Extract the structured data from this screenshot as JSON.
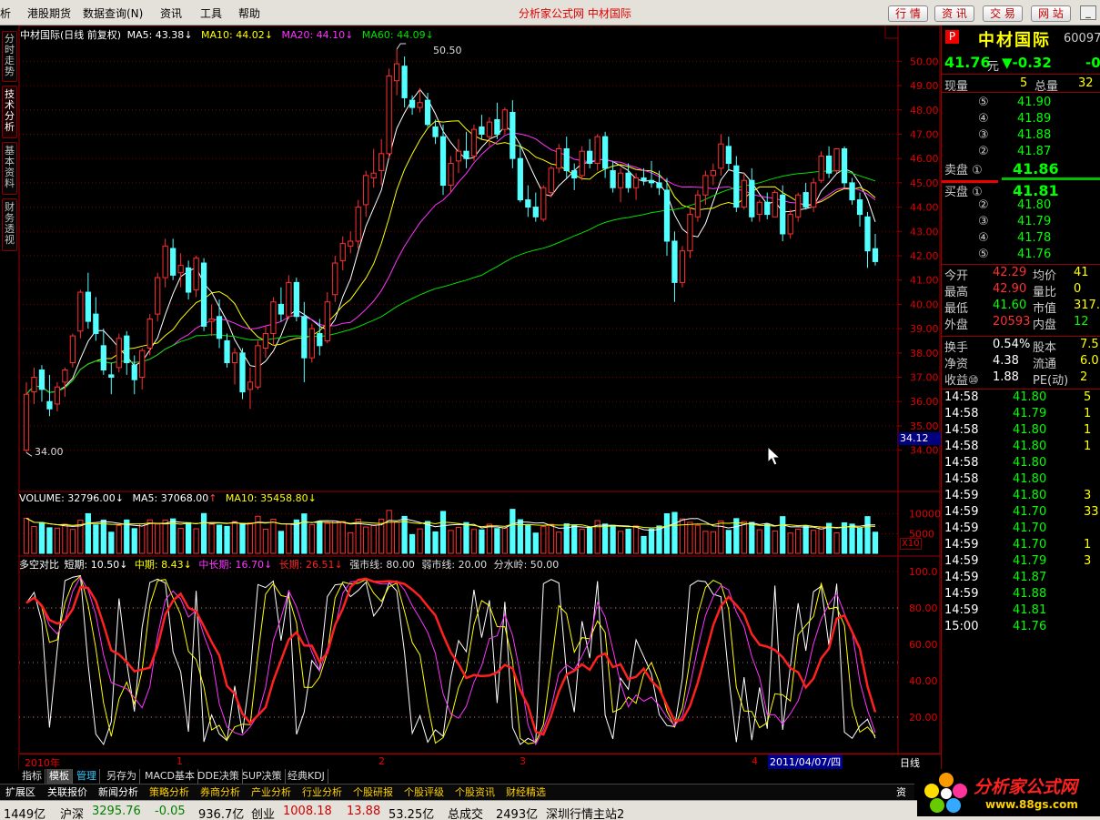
{
  "menubar": {
    "items": [
      "析",
      "港股期货",
      "数据查询(N)",
      "资讯",
      "工具",
      "帮助"
    ],
    "title": "分析家公式网 中材国际",
    "buttons": [
      "行 情",
      "资 讯",
      "交 易",
      "网 站"
    ],
    "win": [
      "_",
      "□",
      "×"
    ]
  },
  "lefttabs": [
    "分时走势",
    "技术分析",
    "基本资料",
    "财务透视"
  ],
  "main": {
    "stock_name": "中材国际(日线 前复权)",
    "ma": [
      {
        "label": "MA5: 43.38",
        "color": "#ffffff",
        "arrow": "↓"
      },
      {
        "label": "MA10: 44.02",
        "color": "#ffff00",
        "arrow": "↓"
      },
      {
        "label": "MA20: 44.10",
        "color": "#ff33ff",
        "arrow": "↓"
      },
      {
        "label": "MA60: 44.09",
        "color": "#00e000",
        "arrow": "↓"
      }
    ],
    "high_marker": "50.50",
    "low_marker": "34.00",
    "price_axis": [
      "50.00",
      "49.00",
      "48.00",
      "47.00",
      "46.00",
      "45.00",
      "44.00",
      "43.00",
      "42.00",
      "41.00",
      "40.00",
      "39.00",
      "38.00",
      "37.00",
      "36.00",
      "35.00",
      "34.00"
    ],
    "cursor_price": "34.12"
  },
  "volume": {
    "vol_label": "VOLUME: 32796.00",
    "vol_arrow": "↓",
    "ma5_label": "MA5: 37068.00",
    "ma5_arrow": "↑",
    "ma10_label": "MA10: 35458.80",
    "ma10_arrow": "↓",
    "axis": [
      "10000",
      "5000"
    ],
    "unit": "X10"
  },
  "indicator": {
    "name": "多空对比",
    "short": "短期: 10.50",
    "mid": "中期: 8.43",
    "midlong": "中长期: 16.70",
    "long": "长期: 26.51",
    "strong": "强市线: 80.00",
    "weak": "弱市线: 20.00",
    "water": "分水岭: 50.00",
    "axis": [
      "100.0",
      "80.00",
      "60.00",
      "40.00",
      "20.00"
    ]
  },
  "datebar": {
    "year": "2010年",
    "months": [
      "1",
      "2",
      "3",
      "4"
    ],
    "cursor_date": "2011/04/07/四",
    "period": "日线"
  },
  "quote": {
    "code": "P",
    "name": "中材国际",
    "code_num": "60097",
    "price": "41.76",
    "price_unit": "元",
    "change": "▼-0.32",
    "change2": "-0",
    "now_vol_label": "现量",
    "now_vol": "5",
    "total_label": "总量",
    "total": "32",
    "sells": [
      {
        "idx": "⑤",
        "price": "41.90"
      },
      {
        "idx": "④",
        "price": "41.89"
      },
      {
        "idx": "③",
        "price": "41.88"
      },
      {
        "idx": "②",
        "price": "41.87"
      },
      {
        "idx": "卖盘 ①",
        "price": "41.86"
      }
    ],
    "buys": [
      {
        "idx": "买盘 ①",
        "price": "41.81"
      },
      {
        "idx": "②",
        "price": "41.80"
      },
      {
        "idx": "③",
        "price": "41.79"
      },
      {
        "idx": "④",
        "price": "41.78"
      },
      {
        "idx": "⑤",
        "price": "41.76"
      }
    ],
    "stats": [
      {
        "l1": "今开",
        "v1": "42.29",
        "l2": "均价",
        "v2": "41"
      },
      {
        "l1": "最高",
        "v1": "42.90",
        "l2": "量比",
        "v2": "0"
      },
      {
        "l1": "最低",
        "v1": "41.60",
        "l2": "市值",
        "v2": "317."
      },
      {
        "l1": "外盘",
        "v1": "20593",
        "l2": "内盘",
        "v2": "12"
      }
    ],
    "fund": [
      {
        "l1": "换手",
        "v1": "0.54%",
        "l2": "股本",
        "v2": "7.5"
      },
      {
        "l1": "净资",
        "v1": "4.38",
        "l2": "流通",
        "v2": "6.0"
      },
      {
        "l1": "收益⑩",
        "v1": "1.88",
        "l2": "PE(动)",
        "v2": "2"
      }
    ],
    "ticks": [
      {
        "t": "14:58",
        "p": "41.80",
        "v": "5"
      },
      {
        "t": "14:58",
        "p": "41.79",
        "v": "1"
      },
      {
        "t": "14:58",
        "p": "41.80",
        "v": "1"
      },
      {
        "t": "14:58",
        "p": "41.80",
        "v": "1"
      },
      {
        "t": "14:58",
        "p": "41.80",
        "v": ""
      },
      {
        "t": "14:58",
        "p": "41.80",
        "v": ""
      },
      {
        "t": "14:59",
        "p": "41.80",
        "v": "3"
      },
      {
        "t": "14:59",
        "p": "41.70",
        "v": "33"
      },
      {
        "t": "14:59",
        "p": "41.70",
        "v": ""
      },
      {
        "t": "14:59",
        "p": "41.70",
        "v": "1"
      },
      {
        "t": "14:59",
        "p": "41.79",
        "v": "3"
      },
      {
        "t": "14:59",
        "p": "41.87",
        "v": ""
      },
      {
        "t": "14:59",
        "p": "41.88",
        "v": ""
      },
      {
        "t": "14:59",
        "p": "41.81",
        "v": ""
      },
      {
        "t": "15:00",
        "p": "41.76",
        "v": ""
      }
    ]
  },
  "tabs1": [
    "指标",
    "模板",
    "管理",
    "另存为",
    "MACD基本",
    "DDE决策",
    "SUP决策",
    "经典KDJ"
  ],
  "tabs2": [
    "扩展区",
    "关联报价",
    "新闻分析",
    "策略分析",
    "券商分析",
    "产业分析",
    "行业分析",
    "个股研报",
    "个股评级",
    "个股资讯",
    "财经精选",
    "资讯"
  ],
  "status": {
    "s1": "1449亿",
    "s2": "沪深",
    "s3": "3295.76",
    "s4": "-0.05",
    "s5": "936.7亿",
    "s6": "创业",
    "s7": "1008.18",
    "s8": "13.88",
    "s9": "53.25亿",
    "s10": "总成交",
    "s11": "2493亿",
    "s12": "深圳行情主站2"
  },
  "logo": {
    "text": "分析家公式网",
    "url": "www.88gs.com"
  },
  "chart_data": {
    "type": "candlestick",
    "ohlc": [
      [
        34.0,
        36.8,
        33.9,
        36.3
      ],
      [
        36.4,
        37.4,
        35.9,
        37.0
      ],
      [
        37.3,
        37.5,
        36.0,
        36.5
      ],
      [
        36.0,
        37.1,
        35.4,
        35.7
      ],
      [
        35.9,
        36.8,
        35.6,
        36.6
      ],
      [
        36.8,
        37.4,
        36.2,
        37.3
      ],
      [
        37.6,
        38.8,
        37.4,
        38.7
      ],
      [
        38.9,
        40.6,
        38.6,
        40.5
      ],
      [
        40.5,
        41.3,
        39.0,
        39.3
      ],
      [
        39.6,
        40.3,
        38.5,
        38.8
      ],
      [
        38.3,
        39.0,
        37.1,
        37.3
      ],
      [
        37.1,
        37.6,
        36.3,
        37.0
      ],
      [
        37.4,
        38.8,
        37.2,
        38.6
      ],
      [
        38.7,
        38.9,
        37.1,
        37.6
      ],
      [
        37.5,
        37.9,
        36.3,
        36.9
      ],
      [
        37.0,
        38.2,
        36.5,
        38.1
      ],
      [
        38.2,
        39.6,
        37.9,
        39.4
      ],
      [
        39.6,
        41.3,
        39.3,
        41.1
      ],
      [
        41.1,
        42.7,
        40.7,
        42.4
      ],
      [
        42.3,
        42.7,
        41.0,
        41.2
      ],
      [
        41.3,
        42.1,
        40.7,
        41.6
      ],
      [
        41.5,
        41.8,
        40.2,
        40.5
      ],
      [
        40.6,
        42.0,
        40.3,
        41.9
      ],
      [
        41.7,
        41.9,
        38.9,
        39.1
      ],
      [
        39.3,
        40.0,
        38.7,
        39.4
      ],
      [
        39.5,
        40.2,
        38.2,
        38.6
      ],
      [
        38.5,
        38.8,
        37.4,
        37.6
      ],
      [
        37.6,
        38.2,
        36.7,
        38.0
      ],
      [
        38.0,
        38.2,
        36.1,
        36.4
      ],
      [
        36.5,
        37.4,
        35.7,
        36.8
      ],
      [
        36.6,
        38.5,
        36.5,
        38.3
      ],
      [
        38.2,
        39.1,
        37.8,
        38.8
      ],
      [
        38.8,
        40.3,
        38.3,
        40.1
      ],
      [
        40.0,
        40.7,
        39.3,
        39.6
      ],
      [
        39.5,
        41.2,
        39.4,
        40.9
      ],
      [
        40.9,
        41.1,
        39.3,
        39.5
      ],
      [
        39.5,
        40.1,
        36.8,
        37.8
      ],
      [
        37.8,
        39.2,
        37.6,
        39.0
      ],
      [
        38.8,
        39.4,
        37.9,
        38.3
      ],
      [
        38.5,
        40.5,
        38.4,
        40.1
      ],
      [
        40.4,
        42.0,
        40.1,
        41.7
      ],
      [
        41.8,
        42.8,
        41.4,
        42.5
      ],
      [
        42.4,
        43.0,
        42.1,
        42.6
      ],
      [
        42.6,
        44.3,
        42.3,
        44.0
      ],
      [
        44.1,
        45.5,
        43.6,
        45.3
      ],
      [
        45.2,
        46.4,
        44.8,
        45.4
      ],
      [
        45.5,
        46.8,
        44.9,
        46.2
      ],
      [
        46.2,
        49.7,
        46.0,
        49.4
      ],
      [
        49.2,
        50.5,
        48.6,
        49.9
      ],
      [
        49.8,
        50.2,
        48.1,
        48.5
      ],
      [
        48.4,
        48.6,
        47.8,
        48.1
      ],
      [
        48.1,
        48.9,
        47.9,
        48.3
      ],
      [
        48.4,
        48.7,
        47.3,
        47.4
      ],
      [
        47.3,
        47.6,
        46.6,
        46.9
      ],
      [
        46.9,
        47.4,
        44.5,
        44.9
      ],
      [
        44.9,
        46.1,
        44.6,
        45.8
      ],
      [
        45.9,
        46.8,
        45.4,
        46.3
      ],
      [
        46.3,
        47.1,
        45.6,
        46.0
      ],
      [
        46.1,
        47.4,
        45.9,
        47.2
      ],
      [
        47.3,
        47.8,
        46.8,
        47.0
      ],
      [
        46.9,
        47.7,
        46.5,
        47.5
      ],
      [
        47.6,
        48.3,
        46.8,
        47.0
      ],
      [
        47.2,
        48.1,
        47.0,
        48.0
      ],
      [
        47.9,
        48.4,
        45.6,
        46.0
      ],
      [
        46.0,
        46.6,
        44.2,
        44.3
      ],
      [
        44.3,
        44.9,
        43.6,
        44.0
      ],
      [
        44.0,
        44.6,
        43.4,
        43.6
      ],
      [
        43.5,
        44.9,
        43.4,
        44.8
      ],
      [
        44.6,
        45.7,
        44.4,
        45.6
      ],
      [
        45.6,
        46.6,
        45.4,
        46.4
      ],
      [
        46.4,
        46.9,
        45.2,
        45.5
      ],
      [
        45.5,
        45.8,
        44.7,
        45.2
      ],
      [
        45.3,
        46.5,
        45.1,
        46.3
      ],
      [
        46.3,
        46.8,
        45.6,
        45.8
      ],
      [
        45.8,
        47.0,
        45.5,
        46.9
      ],
      [
        46.9,
        47.1,
        45.2,
        45.6
      ],
      [
        45.5,
        45.9,
        44.6,
        44.8
      ],
      [
        44.8,
        45.6,
        44.2,
        45.4
      ],
      [
        45.4,
        45.8,
        44.6,
        44.8
      ],
      [
        44.8,
        45.4,
        44.3,
        45.2
      ],
      [
        45.2,
        45.6,
        44.9,
        45.1
      ],
      [
        45.1,
        45.9,
        44.8,
        45.0
      ],
      [
        45.0,
        45.5,
        44.5,
        44.8
      ],
      [
        44.7,
        45.2,
        42.0,
        42.6
      ],
      [
        42.6,
        43.0,
        40.1,
        40.9
      ],
      [
        40.9,
        42.4,
        40.7,
        42.2
      ],
      [
        42.2,
        44.0,
        41.9,
        43.7
      ],
      [
        43.6,
        44.7,
        43.4,
        44.5
      ],
      [
        44.5,
        45.5,
        44.1,
        45.3
      ],
      [
        45.3,
        45.8,
        44.9,
        45.5
      ],
      [
        45.6,
        47.0,
        45.3,
        46.6
      ],
      [
        46.5,
        46.9,
        45.5,
        45.8
      ],
      [
        45.7,
        46.1,
        43.8,
        44.0
      ],
      [
        44.0,
        45.4,
        43.9,
        45.1
      ],
      [
        45.1,
        45.6,
        43.4,
        43.6
      ],
      [
        43.7,
        44.3,
        43.4,
        44.2
      ],
      [
        44.2,
        44.6,
        43.5,
        43.7
      ],
      [
        43.6,
        44.7,
        43.6,
        44.6
      ],
      [
        44.5,
        44.9,
        42.6,
        42.9
      ],
      [
        42.9,
        43.9,
        42.7,
        43.7
      ],
      [
        43.6,
        44.6,
        43.4,
        44.5
      ],
      [
        44.6,
        45.0,
        43.9,
        44.0
      ],
      [
        44.0,
        45.2,
        43.8,
        45.0
      ],
      [
        45.1,
        46.3,
        45.0,
        46.1
      ],
      [
        46.1,
        46.5,
        45.2,
        45.4
      ],
      [
        45.5,
        46.4,
        45.4,
        46.4
      ],
      [
        46.4,
        46.5,
        44.8,
        45.0
      ],
      [
        45.0,
        45.2,
        44.1,
        44.3
      ],
      [
        44.3,
        44.6,
        43.2,
        43.7
      ],
      [
        43.6,
        43.8,
        41.5,
        42.2
      ],
      [
        42.29,
        42.9,
        41.6,
        41.76
      ]
    ],
    "xlabel": "",
    "ylabel": "",
    "ylim": [
      33.5,
      50.8
    ]
  }
}
